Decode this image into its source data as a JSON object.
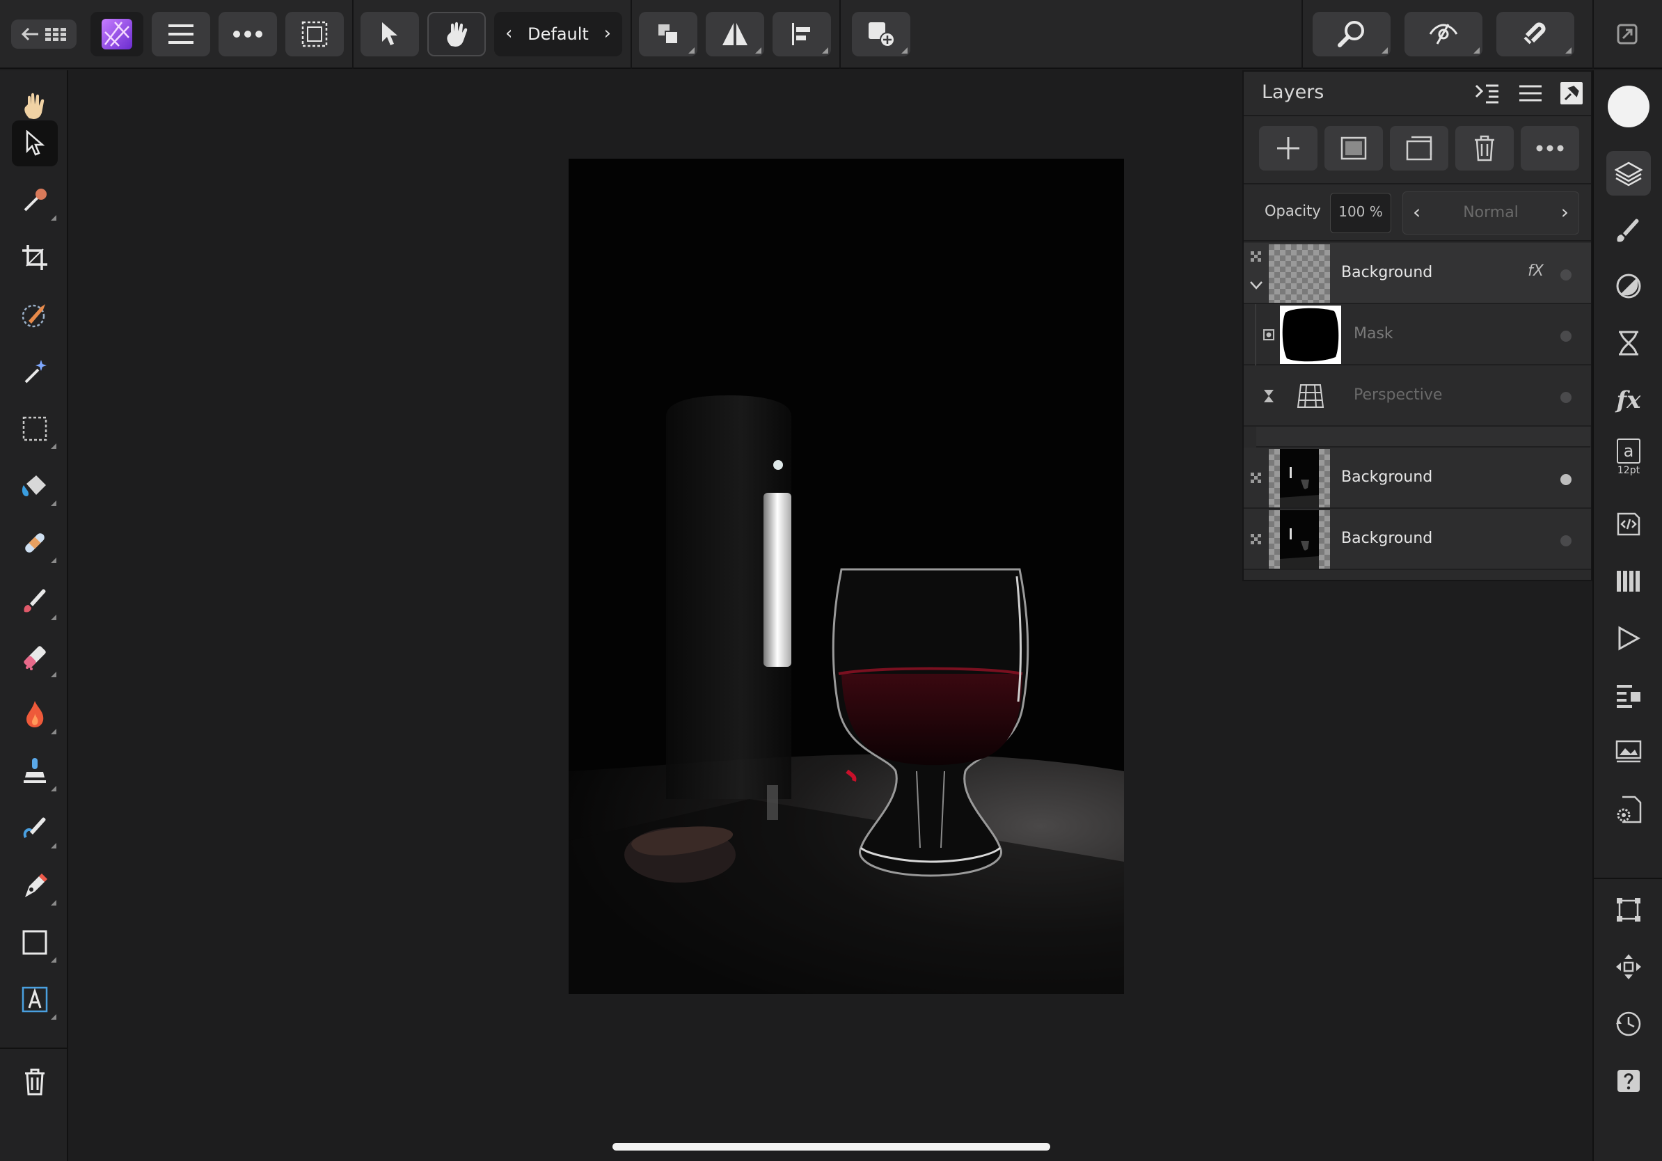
{
  "toolbar": {
    "preset_label": "Default"
  },
  "layers_panel": {
    "title": "Layers",
    "opacity_label": "Opacity",
    "opacity_value": "100 %",
    "blend_mode": "Normal",
    "fx_label": "fX",
    "layers": [
      {
        "name": "Background"
      },
      {
        "name": "Mask"
      },
      {
        "name": "Perspective"
      },
      {
        "name": "Background"
      },
      {
        "name": "Background"
      }
    ]
  },
  "studio": {
    "text_size": "12pt",
    "text_glyph": "a"
  }
}
